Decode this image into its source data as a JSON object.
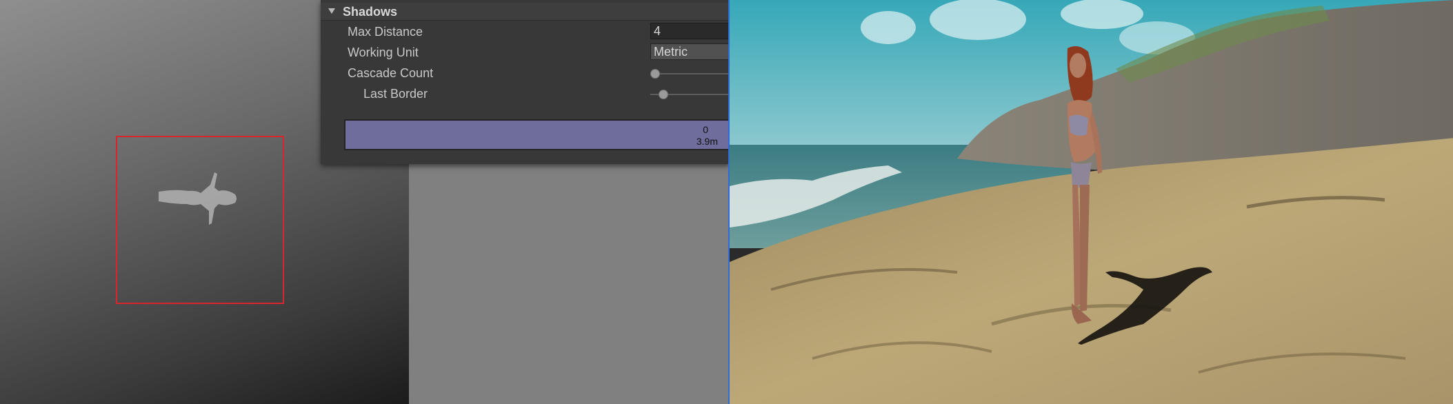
{
  "inspector": {
    "section_title": "Shadows",
    "fields": {
      "max_distance": {
        "label": "Max Distance",
        "value": "4"
      },
      "working_unit": {
        "label": "Working Unit",
        "value": "Metric"
      },
      "cascade_count": {
        "label": "Cascade Count",
        "value": 0.0
      },
      "last_border": {
        "label": "Last Border",
        "value": 0.1
      }
    },
    "cascade_split": {
      "index": "0",
      "distance": "3.9m"
    }
  },
  "colors": {
    "selection_frame": "#d7262c",
    "scene_view_border": "#2e6bd8",
    "cascade_bar": "#6e6d9c"
  },
  "icons": {
    "foldout": "triangle-down-icon"
  }
}
